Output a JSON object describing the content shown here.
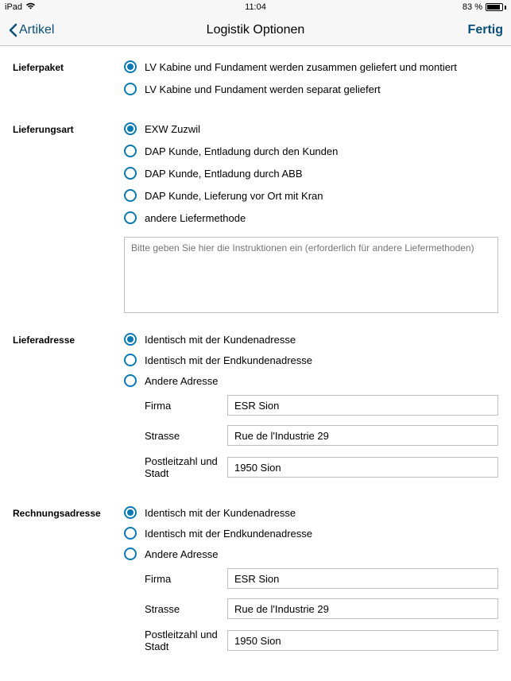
{
  "statusbar": {
    "device": "iPad",
    "time": "11:04",
    "battery_text": "83 %"
  },
  "navbar": {
    "back_label": "Artikel",
    "title": "Logistik Optionen",
    "done_label": "Fertig"
  },
  "sections": {
    "lieferpaket": {
      "label": "Lieferpaket",
      "options": [
        "LV Kabine und Fundament werden zusammen geliefert und montiert",
        "LV Kabine und Fundament werden separat geliefert"
      ],
      "selected": 0
    },
    "lieferungsart": {
      "label": "Lieferungsart",
      "options": [
        "EXW Zuzwil",
        "DAP Kunde, Entladung durch den Kunden",
        "DAP Kunde, Entladung durch ABB",
        "DAP Kunde, Lieferung vor Ort mit Kran",
        "andere Liefermethode"
      ],
      "selected": 0,
      "textarea_placeholder": "Bitte geben Sie hier die Instruktionen ein (erforderlich für andere Liefermethoden)"
    },
    "lieferadresse": {
      "label": "Lieferadresse",
      "options": [
        "Identisch mit der Kundenadresse",
        "Identisch mit der Endkundenadresse",
        "Andere Adresse"
      ],
      "selected": 0,
      "fields": {
        "firma_label": "Firma",
        "firma_value": "ESR Sion",
        "strasse_label": "Strasse",
        "strasse_value": "Rue de l'Industrie 29",
        "plz_label": "Postleitzahl und Stadt",
        "plz_value": "1950 Sion"
      }
    },
    "rechnungsadresse": {
      "label": "Rechnungsadresse",
      "options": [
        "Identisch mit der Kundenadresse",
        "Identisch mit der Endkundenadresse",
        "Andere Adresse"
      ],
      "selected": 0,
      "fields": {
        "firma_label": "Firma",
        "firma_value": "ESR Sion",
        "strasse_label": "Strasse",
        "strasse_value": "Rue de l'Industrie 29",
        "plz_label": "Postleitzahl und Stadt",
        "plz_value": "1950 Sion"
      }
    }
  }
}
